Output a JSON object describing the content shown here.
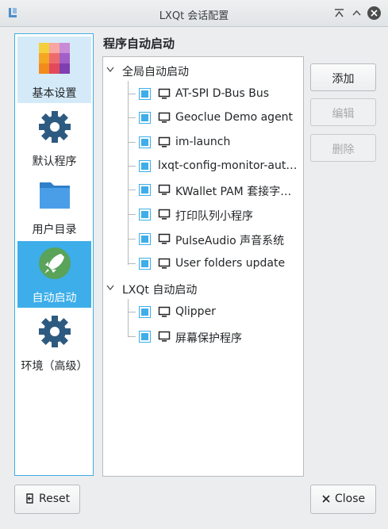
{
  "window": {
    "title": "LXQt 会话配置"
  },
  "sidebar": {
    "items": [
      {
        "label": "基本设置",
        "icon": "palette-icon"
      },
      {
        "label": "默认程序",
        "icon": "gear-icon"
      },
      {
        "label": "用户目录",
        "icon": "folder-icon"
      },
      {
        "label": "自动启动",
        "icon": "rocket-icon"
      },
      {
        "label": "环境（高级）",
        "icon": "gear-icon"
      }
    ]
  },
  "section_title": "程序自动启动",
  "tree": {
    "groups": [
      {
        "label": "全局自动启动",
        "items": [
          {
            "label": "AT-SPI D-Bus Bus",
            "checked": true,
            "icon": "monitor-icon"
          },
          {
            "label": "Geoclue Demo agent",
            "checked": true,
            "icon": "monitor-icon"
          },
          {
            "label": "im-launch",
            "checked": true,
            "icon": "monitor-icon"
          },
          {
            "label": "lxqt-config-monitor-aut…",
            "checked": true,
            "icon": ""
          },
          {
            "label": "KWallet PAM 套接字…",
            "checked": true,
            "icon": "monitor-icon"
          },
          {
            "label": "打印队列小程序",
            "checked": true,
            "icon": "monitor-icon"
          },
          {
            "label": "PulseAudio 声音系统",
            "checked": true,
            "icon": "monitor-icon"
          },
          {
            "label": "User folders update",
            "checked": true,
            "icon": "monitor-icon"
          }
        ]
      },
      {
        "label": "LXQt 自动启动",
        "items": [
          {
            "label": "Qlipper",
            "checked": true,
            "icon": "monitor-icon"
          },
          {
            "label": "屏幕保护程序",
            "checked": true,
            "icon": "monitor-icon"
          }
        ]
      }
    ]
  },
  "buttons": {
    "add": "添加",
    "edit": "编辑",
    "delete": "删除",
    "reset": "Reset",
    "close": "Close"
  },
  "colors": {
    "accent": "#3daee9",
    "window_bg": "#ecedee"
  }
}
